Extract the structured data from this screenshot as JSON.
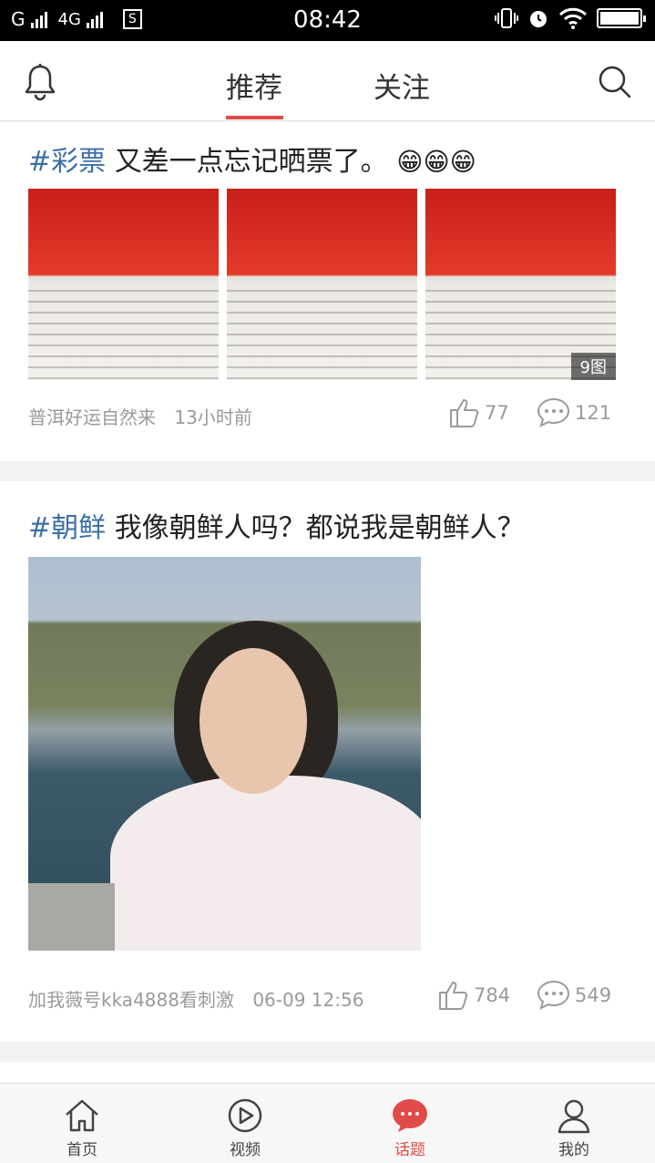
{
  "status_bar": {
    "carrier": "G",
    "network": "4G",
    "sim_icon": "S",
    "time": "08:42",
    "icons": [
      "vibrate-icon",
      "alarm-icon",
      "wifi-icon",
      "battery-icon"
    ],
    "battery_level": 1.0
  },
  "header": {
    "tabs": [
      {
        "label": "推荐",
        "active": true
      },
      {
        "label": "关注",
        "active": false
      }
    ],
    "left_icon": "bell-icon",
    "right_icon": "search-icon",
    "accent_color": "#e04a48"
  },
  "posts": [
    {
      "topic": "#彩票",
      "text": "又差一点忘记晒票了。",
      "emoji": [
        "😁",
        "😁",
        "😁"
      ],
      "images": [
        "lottery-ticket-1",
        "lottery-ticket-2",
        "lottery-ticket-3"
      ],
      "image_count_badge": "9图",
      "author": "普洱好运自然来",
      "time": "13小时前",
      "likes": "77",
      "comments": "121"
    },
    {
      "topic": "#朝鲜",
      "text": "我像朝鲜人吗？都说我是朝鲜人？",
      "images": [
        "portrait-photo"
      ],
      "author": "加我薇号kka4888看刺激",
      "time": "06-09 12:56",
      "likes": "784",
      "comments": "549"
    }
  ],
  "bottom_nav": [
    {
      "label": "首页",
      "icon": "home-icon",
      "active": false
    },
    {
      "label": "视频",
      "icon": "play-icon",
      "active": false
    },
    {
      "label": "话题",
      "icon": "chat-bubble-icon",
      "active": true
    },
    {
      "label": "我的",
      "icon": "user-icon",
      "active": false
    }
  ],
  "topic_color": "#3d6fa6"
}
